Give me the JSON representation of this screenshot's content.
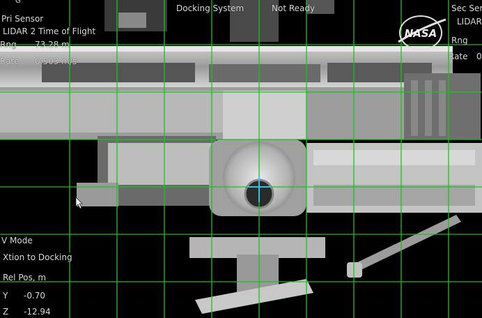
{
  "header": {
    "left_glyph": "G",
    "pri_sensor_label": "Pri Sensor",
    "pri_sensor_value": "LIDAR 2 Time of Flight",
    "title": "Docking System",
    "status": "Not Ready",
    "sec_sensor_label": "Sec Ser",
    "sec_sensor_value": "LIDAR"
  },
  "pri_readouts": {
    "rng_label": "Rng",
    "rng_value": "73.28 m",
    "rate_label": "Rate",
    "rate_value": "0.503 m/s"
  },
  "sec_readouts": {
    "rng_label": "Rng",
    "rate_label": "Rate",
    "rate_value": "0"
  },
  "mode": {
    "label": "V Mode",
    "value": "Xtion to Docking"
  },
  "rel_pos": {
    "label": "Rel Pos, m",
    "y_label": "Y",
    "y_value": "-0.70",
    "z_label": "Z",
    "z_value": "-12.94"
  },
  "logo": {
    "text": "NASA",
    "icon": "nasa-meatball-logo"
  },
  "colors": {
    "grid": "#19c419",
    "crosshair": "#29c6e6",
    "hud_text": "#d8d8d8",
    "background": "#000000"
  }
}
